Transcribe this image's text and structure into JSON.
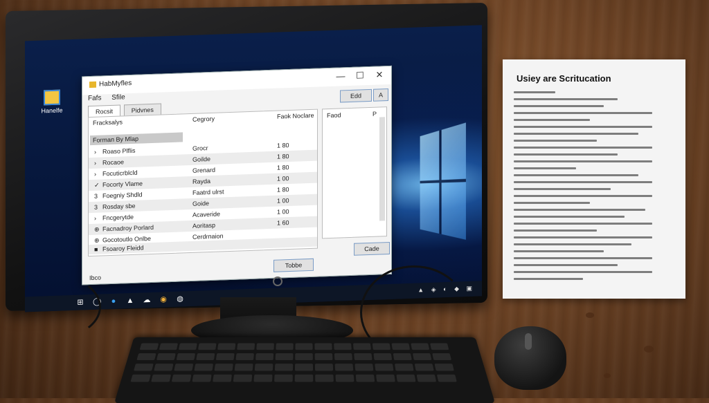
{
  "desktop": {
    "icon_label": "Hanelfe"
  },
  "window": {
    "title": "HabMyfles",
    "minimize": "—",
    "maximize": "☐",
    "close": "✕",
    "menu": [
      "Fafs",
      "Sfile"
    ],
    "tabs": [
      "Rocsit",
      "Pidvnes"
    ],
    "list_headers": {
      "name": "Fracksalys",
      "category": "Cegrory",
      "amount": "Faok Noclare"
    },
    "group_label": "Forman By Mlap",
    "rows": [
      {
        "icon": "›",
        "name": "Roaso Plflis",
        "category": "Grocr",
        "amount": "1 80"
      },
      {
        "icon": "›",
        "name": "Rocaoe",
        "category": "Goilde",
        "amount": "1 80"
      },
      {
        "icon": "›",
        "name": "Focuticrblcld",
        "category": "Grenard",
        "amount": "1 80"
      },
      {
        "icon": "✓",
        "name": "Focorty Vlame",
        "category": "Rayda",
        "amount": "1 00"
      },
      {
        "icon": "3",
        "name": "Foegniy Shdld",
        "category": "Faatrd ulrst",
        "amount": "1 80"
      },
      {
        "icon": "3",
        "name": "Rosday sbe",
        "category": "Goide",
        "amount": "1 00"
      },
      {
        "icon": "›",
        "name": "Fncgerytde",
        "category": "Acaveride",
        "amount": "1 00"
      },
      {
        "icon": "⊕",
        "name": "Facnadroy Porlard",
        "category": "Aoritasp",
        "amount": "1 60"
      },
      {
        "icon": "⊕",
        "name": "Gocotoutlo Onlbe",
        "category": "Cerdrnaion",
        "amount": ""
      },
      {
        "icon": "■",
        "name": "Fsoaroy Fleidd",
        "category": "",
        "amount": ""
      }
    ],
    "side_header": "Faod",
    "side_marker": "P",
    "button_top": "Edd",
    "button_top_right": "A",
    "button_cancel": "Cade",
    "button_bottom": "Tobbe",
    "status": "Ibco"
  },
  "taskbar": {
    "icons": [
      "⊞",
      "◯",
      "●",
      "▲",
      "☁",
      "◉",
      "◍"
    ],
    "tray": "▲ ◈ ◐ ◆ ▣"
  },
  "paper": {
    "title": "Usiey are Scritucation"
  }
}
